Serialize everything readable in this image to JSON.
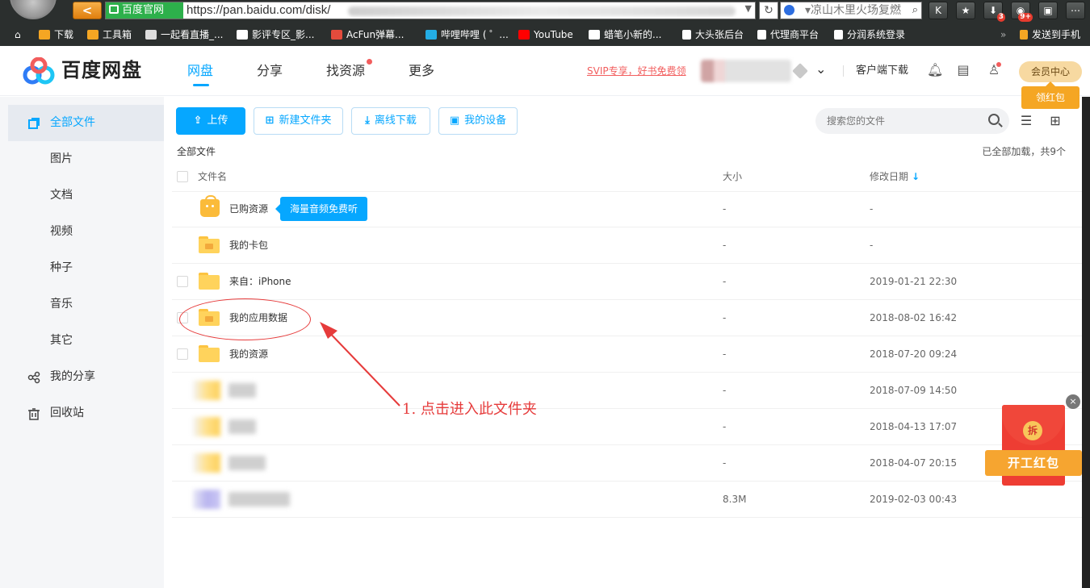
{
  "browser": {
    "back_label": "<",
    "site_badge": "百度官网",
    "url": "https://pan.baidu.com/disk/",
    "search_query": "凉山木里火场复燃",
    "toolbar_badges": {
      "downloads": "3",
      "games": "9+"
    },
    "bookmarks": [
      {
        "label": "下载",
        "icon": "folder-icon",
        "color": "#f5a623"
      },
      {
        "label": "工具箱",
        "icon": "folder-icon",
        "color": "#f5a623"
      },
      {
        "label": "一起看直播_...",
        "icon": "site-icon",
        "color": "#dddddd"
      },
      {
        "label": "影评专区_影...",
        "icon": "panda-icon",
        "color": "#ffffff"
      },
      {
        "label": "AcFun弹幕...",
        "icon": "acfun-icon",
        "color": "#e34b3c"
      },
      {
        "label": "哔哩哔哩 ( ゜...",
        "icon": "bilibili-icon",
        "color": "#23ade5"
      },
      {
        "label": "YouTube",
        "icon": "youtube-icon",
        "color": "#ff0000"
      },
      {
        "label": "蜡笔小新的...",
        "icon": "panda-icon",
        "color": "#ffffff"
      },
      {
        "label": "大头张后台",
        "icon": "page-icon",
        "color": "#ffffff"
      },
      {
        "label": "代理商平台",
        "icon": "page-icon",
        "color": "#ffffff"
      },
      {
        "label": "分润系统登录",
        "icon": "page-icon",
        "color": "#ffffff"
      }
    ],
    "overflow": "»",
    "send_to_phone": "发送到手机"
  },
  "header": {
    "logo_text": "百度网盘",
    "nav": [
      {
        "label": "网盘",
        "active": true
      },
      {
        "label": "分享",
        "active": false
      },
      {
        "label": "找资源",
        "active": false,
        "has_dot": true
      },
      {
        "label": "更多",
        "active": false
      }
    ],
    "svip_link": "SVIP专享，好书免费领",
    "client_download": "客户端下载",
    "vip_center": "会员中心",
    "red_packet": "领红包"
  },
  "sidebar": {
    "items": [
      {
        "label": "全部文件",
        "active": true
      },
      {
        "label": "图片"
      },
      {
        "label": "文档"
      },
      {
        "label": "视频"
      },
      {
        "label": "种子"
      },
      {
        "label": "音乐"
      },
      {
        "label": "其它"
      },
      {
        "label": "我的分享"
      },
      {
        "label": "回收站"
      }
    ]
  },
  "toolbar": {
    "upload": "上传",
    "new_folder": "新建文件夹",
    "offline_download": "离线下载",
    "my_devices": "我的设备",
    "search_placeholder": "搜索您的文件"
  },
  "files": {
    "breadcrumb": "全部文件",
    "loaded_info": "已全部加载，共9个",
    "columns": {
      "name": "文件名",
      "size": "大小",
      "modified": "修改日期",
      "sort_indicator": "↓"
    },
    "rows": [
      {
        "name": "已购资源",
        "size": "-",
        "date": "-"
      },
      {
        "name": "我的卡包",
        "size": "-",
        "date": "-"
      },
      {
        "name": "来自：iPhone",
        "size": "-",
        "date": "2019-01-21 22:30"
      },
      {
        "name": "我的应用数据",
        "size": "-",
        "date": "2018-08-02 16:42"
      },
      {
        "name": "我的资源",
        "size": "-",
        "date": "2018-07-20 09:24"
      },
      {
        "name": "",
        "size": "-",
        "date": "2018-07-09 14:50"
      },
      {
        "name": "",
        "size": "-",
        "date": "2018-04-13 17:07"
      },
      {
        "name": "",
        "size": "-",
        "date": "2018-04-07 20:15"
      },
      {
        "name": "",
        "size": "8.3M",
        "date": "2019-02-03 00:43"
      }
    ],
    "tooltip": "海量音频免费听"
  },
  "annotation": {
    "text": "1. 点击进入此文件夹",
    "color": "#e63b3b"
  },
  "promo": {
    "coin": "拆",
    "label": "开工红包",
    "close": "×"
  },
  "colors": {
    "accent": "#06a7ff",
    "danger": "#f25d5d"
  }
}
